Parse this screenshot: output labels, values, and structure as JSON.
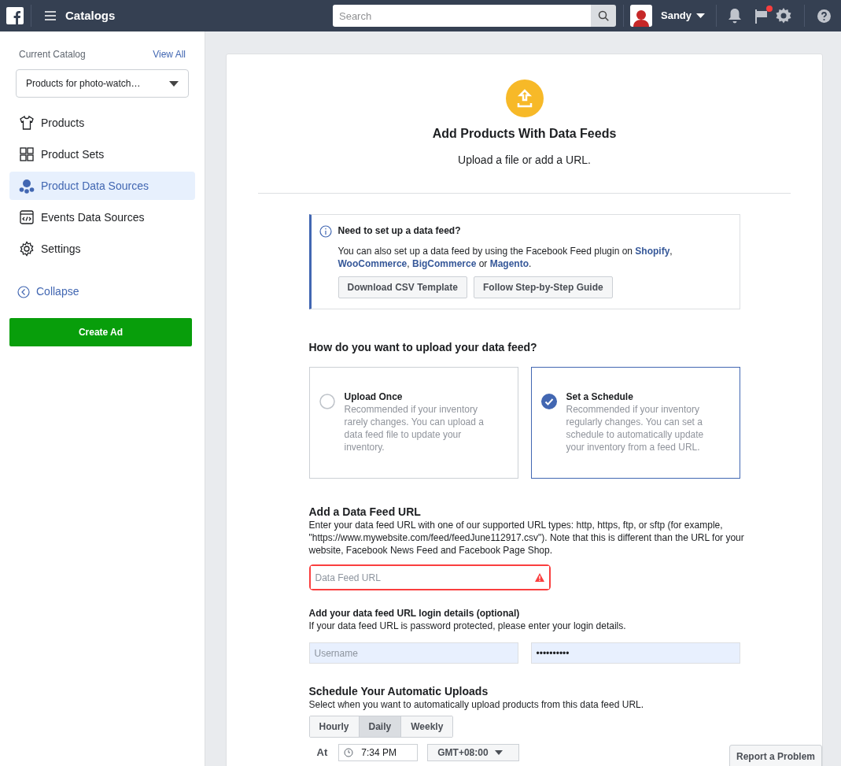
{
  "topbar": {
    "title": "Catalogs",
    "search_placeholder": "Search",
    "user_name": "Sandy",
    "flag_alert": true
  },
  "sidebar": {
    "current_catalog_label": "Current Catalog",
    "view_all": "View All",
    "catalog": "Products for photo-watch…",
    "items": [
      {
        "label": "Products",
        "kind": "shirt",
        "selected": false
      },
      {
        "label": "Product Sets",
        "kind": "grid",
        "selected": false
      },
      {
        "label": "Product Data Sources",
        "kind": "sources",
        "selected": true
      },
      {
        "label": "Events Data Sources",
        "kind": "code",
        "selected": false
      },
      {
        "label": "Settings",
        "kind": "gear",
        "selected": false
      }
    ],
    "collapse": "Collapse",
    "create_ad": "Create Ad"
  },
  "header": {
    "title": "Add Products With Data Feeds",
    "subtitle": "Upload a file or add a URL."
  },
  "info": {
    "title": "Need to set up a data feed?",
    "parts": [
      {
        "text": "You can also set up a data feed by using the Facebook Feed plugin on ",
        "kind": "text"
      },
      {
        "text": "Shopify",
        "kind": "link"
      },
      {
        "text": ", ",
        "kind": "text"
      },
      {
        "text": "WooCommerce",
        "kind": "link"
      },
      {
        "text": ", ",
        "kind": "text"
      },
      {
        "text": "BigCommerce",
        "kind": "link"
      },
      {
        "text": " or ",
        "kind": "text"
      },
      {
        "text": "Magento",
        "kind": "link"
      },
      {
        "text": ".",
        "kind": "text"
      }
    ],
    "buttons": [
      "Download CSV Template",
      "Follow Step-by-Step Guide"
    ]
  },
  "upload": {
    "question": "How do you want to upload your data feed?",
    "options": [
      {
        "title": "Upload Once",
        "description": "Recommended if your inventory rarely changes. You can upload a data feed file to update your inventory.",
        "selected": false
      },
      {
        "title": "Set a Schedule",
        "description": "Recommended if your inventory regularly changes. You can set a schedule to automatically update your inventory from a feed URL.",
        "selected": true
      }
    ]
  },
  "feed_url": {
    "heading": "Add a Data Feed URL",
    "description": "Enter your data feed URL with one of our supported URL types: http, https, ftp, or sftp (for example, \"https://www.mywebsite.com/feed/feedJune112917.csv\"). Note that this is different than the URL for your website, Facebook News Feed and Facebook Page Shop.",
    "placeholder": "Data Feed URL",
    "error": true
  },
  "login": {
    "heading": "Add your data feed URL login details (optional)",
    "description": "If your data feed URL is password protected, please enter your login details.",
    "username_placeholder": "Username",
    "password": "••••••••••"
  },
  "schedule": {
    "heading": "Schedule Your Automatic Uploads",
    "description": "Select when you want to automatically upload products from this data feed URL.",
    "frequencies": [
      {
        "label": "Hourly",
        "selected": false
      },
      {
        "label": "Daily",
        "selected": true
      },
      {
        "label": "Weekly",
        "selected": false
      }
    ],
    "at_label": "At",
    "time": "7:34 PM",
    "timezone": "GMT+08:00"
  },
  "report_button": "Report a Problem"
}
